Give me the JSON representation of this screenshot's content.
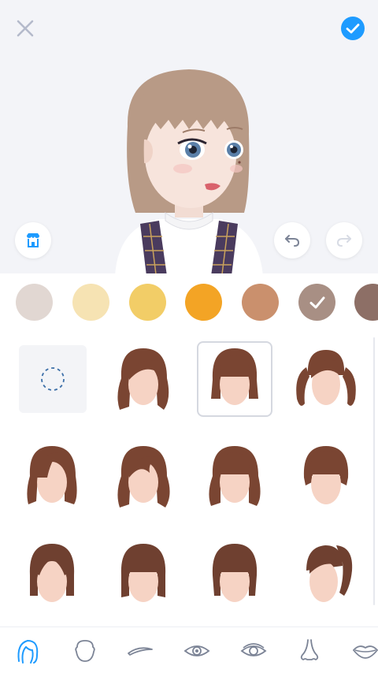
{
  "toolbar": {
    "close_icon": "close-icon",
    "confirm_icon": "check-circle-icon"
  },
  "preview_controls": {
    "store_icon": "store-icon",
    "undo_icon": "undo-icon",
    "redo_icon": "redo-icon"
  },
  "colors": {
    "swatches": [
      "#e1d7d2",
      "#f6e3b3",
      "#f2cd67",
      "#f3a425",
      "#ca906d",
      "#a88f84",
      "#8d6f66"
    ],
    "selected_index": 5,
    "accent": "#1e9bff"
  },
  "hairstyles": {
    "items": [
      "none",
      "side-part-wavy",
      "bangs-bob",
      "twin-tails",
      "side-part-bob",
      "messy-wavy",
      "bangs-wavy",
      "bangs-short-bob",
      "center-part-bob",
      "blunt-bob",
      "bangs-round-bob",
      "ponytail"
    ],
    "selected_index": 2
  },
  "tabs": {
    "items": [
      "hair-icon",
      "face-shape-icon",
      "eyebrow-icon",
      "eye-icon",
      "eye-detail-icon",
      "nose-icon",
      "lips-icon"
    ],
    "selected_index": 0
  }
}
